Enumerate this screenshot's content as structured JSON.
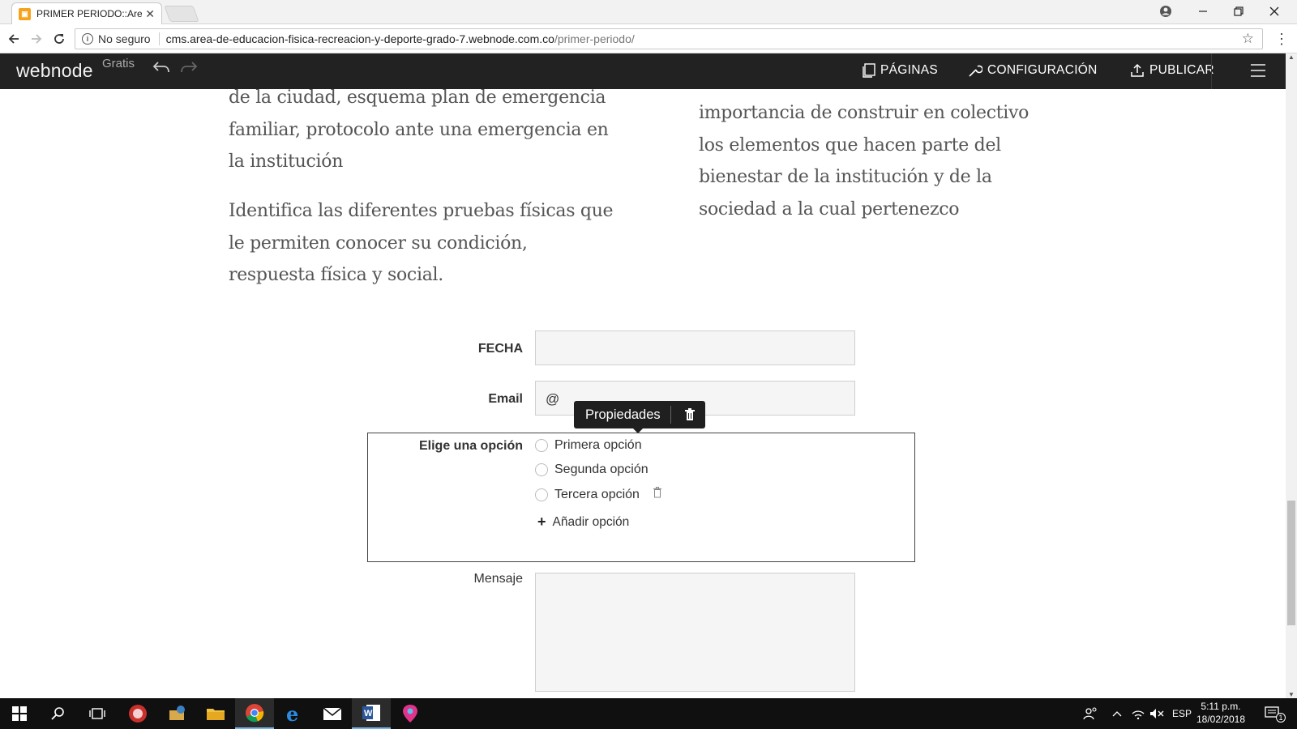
{
  "browser": {
    "tab_title": "PRIMER PERIODO::Area-d",
    "tab_close": "✕",
    "security_label": "No seguro",
    "url_host": "cms.area-de-educacion-fisica-recreacion-y-deporte-grado-7.webnode.com.co",
    "url_path": "/primer-periodo/"
  },
  "webnode": {
    "logo": "webnode",
    "plan": "Gratis",
    "menu": {
      "pages": "PÁGINAS",
      "settings": "CONFIGURACIÓN",
      "publish": "PUBLICAR"
    }
  },
  "content": {
    "left_col_p1": [
      "de la ciudad, esquema plan de emergencia",
      "familiar, protocolo ante una emergencia en",
      "la institución"
    ],
    "left_col_p2": [
      "Identifica las diferentes pruebas físicas que",
      "le permiten conocer su condición,",
      "respuesta física y social."
    ],
    "right_col_p1": [
      "importancia de construir en colectivo",
      "los elementos que hacen parte del",
      "bienestar de la institución y de la",
      "sociedad a la cual pertenezco"
    ]
  },
  "form": {
    "fecha_label": "FECHA",
    "email_label": "Email",
    "email_prefix": "@",
    "tooltip_label": "Propiedades",
    "choice_label": "Elige una opción",
    "options": [
      "Primera opción",
      "Segunda opción",
      "Tercera opción"
    ],
    "add_option": "Añadir opción",
    "message_label": "Mensaje"
  },
  "taskbar": {
    "language": "ESP",
    "time": "5:11 p.m.",
    "date": "18/02/2018",
    "notifications": "1"
  },
  "colors": {
    "webnode_bar": "#222222",
    "taskbar": "#101010",
    "text_gray": "#555555"
  }
}
